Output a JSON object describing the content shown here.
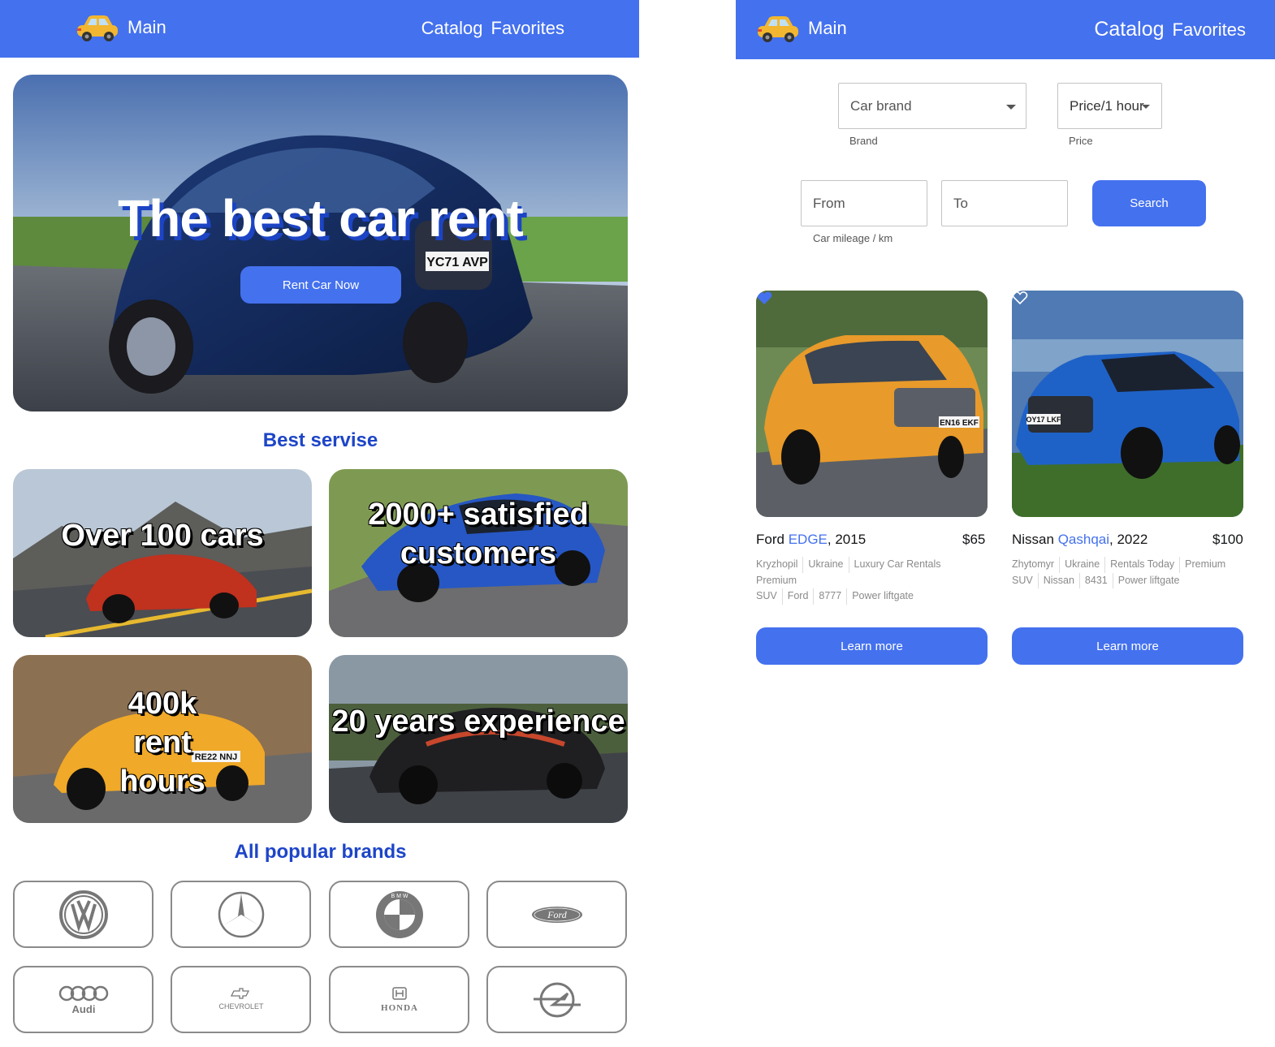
{
  "home": {
    "header": {
      "logo_label": "Main",
      "nav": [
        "Catalog",
        "Favorites"
      ]
    },
    "hero": {
      "title": "The best car rent",
      "button": "Rent Car Now",
      "plate": "YC71 AVP"
    },
    "service_title": "Best servise",
    "tiles": [
      "Over 100 cars",
      "2000+ satisfied customers",
      "400k rent hours",
      "20 years experience"
    ],
    "tile_plate": "RE22 NNJ",
    "brands_title": "All popular brands",
    "brands": [
      {
        "name": "Volkswagen",
        "icon": "volkswagen-logo-icon"
      },
      {
        "name": "Mercedes-Benz",
        "icon": "mercedes-logo-icon"
      },
      {
        "name": "BMW",
        "icon": "bmw-logo-icon",
        "text": "B M W"
      },
      {
        "name": "Ford",
        "icon": "ford-logo-icon",
        "text": "Ford"
      },
      {
        "name": "Audi",
        "icon": "audi-logo-icon",
        "text": "Audi"
      },
      {
        "name": "Chevrolet",
        "icon": "chevrolet-logo-icon",
        "text": "CHEVROLET"
      },
      {
        "name": "Honda",
        "icon": "honda-logo-icon",
        "text": "HONDA"
      },
      {
        "name": "Opel",
        "icon": "opel-logo-icon"
      }
    ]
  },
  "catalog": {
    "header": {
      "logo_label": "Main",
      "nav": [
        "Catalog",
        "Favorites"
      ]
    },
    "filters": {
      "brand": {
        "value": "Car brand",
        "label": "Brand"
      },
      "price": {
        "value": "Price/1 hour",
        "label": "Price"
      },
      "from": {
        "placeholder": "From"
      },
      "to": {
        "placeholder": "To"
      },
      "mileage_label": "Car mileage / km",
      "search_button": "Search"
    },
    "cars": [
      {
        "make": "Ford",
        "model": "EDGE",
        "year": ", 2015",
        "price": "$65",
        "favorited": true,
        "plate": "EN16 EKF",
        "tags_line1": [
          "Kryzhopil",
          "Ukraine",
          "Luxury Car Rentals"
        ],
        "tags_line2": [
          "Premium"
        ],
        "tags_line3": [
          "SUV",
          "Ford",
          "8777",
          "Power liftgate"
        ],
        "button": "Learn more"
      },
      {
        "make": "Nissan",
        "model": "Qashqai",
        "year": ", 2022",
        "price": "$100",
        "favorited": false,
        "plate": "OY17 LKF",
        "tags_line1": [
          "Zhytomyr",
          "Ukraine",
          "Rentals Today",
          "Premium"
        ],
        "tags_line2": [
          "SUV",
          "Nissan",
          "8431",
          "Power liftgate"
        ],
        "tags_line3": [],
        "button": "Learn more"
      }
    ]
  },
  "colors": {
    "accent": "#4471ee",
    "title_blue": "#1d45c8",
    "text": "#121417",
    "muted": "#8a8a8a"
  }
}
